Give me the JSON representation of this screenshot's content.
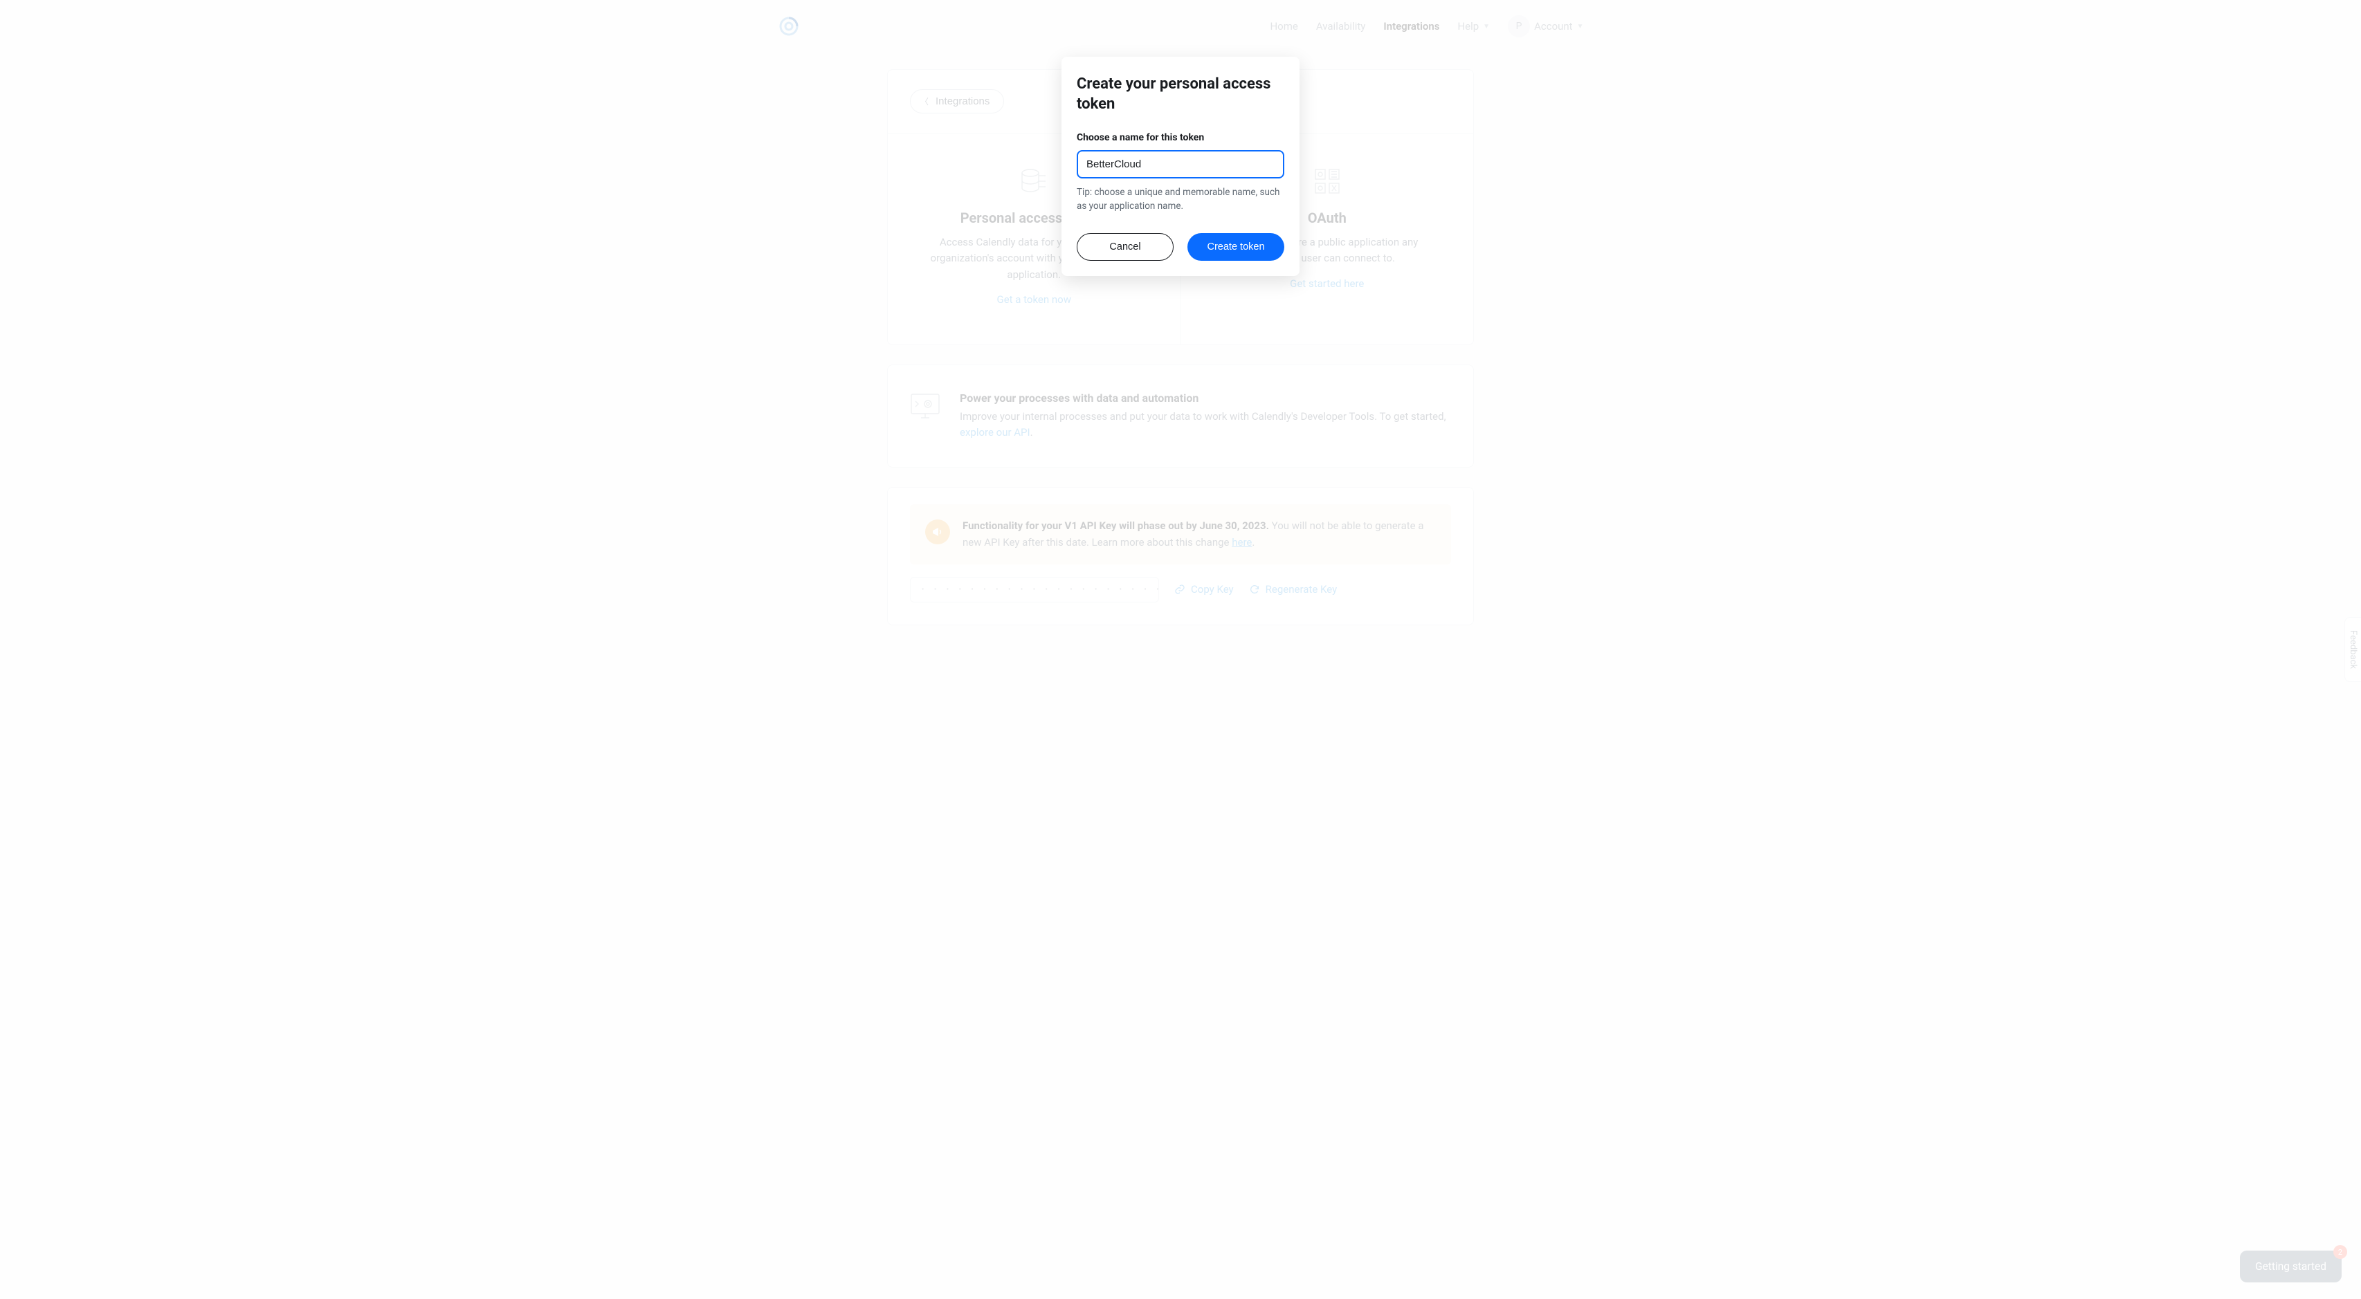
{
  "nav": {
    "home": "Home",
    "availability": "Availability",
    "integrations": "Integrations",
    "help": "Help",
    "account": "Account",
    "avatar_initial": "P"
  },
  "breadcrumb": {
    "back_label": "Integrations"
  },
  "cards": {
    "pat": {
      "title": "Personal access tokens",
      "body": "Access Calendly data for yourself or your organization's account with your own internal application.",
      "cta": "Get a token now"
    },
    "oauth": {
      "title": "OAuth",
      "body": "Build and share a public application any Calendly user can connect to.",
      "cta": "Get started here"
    }
  },
  "automation": {
    "title": "Power your processes with data and automation",
    "body_before_link": "Improve your internal processes and put your data to work with Calendly's Developer Tools. To get started, ",
    "link": "explore our API",
    "body_after_link": "."
  },
  "deprecation": {
    "bold": "Functionality for your V1 API Key will phase out by June 30, 2023.",
    "rest": " You will not be able to generate a new API Key after this date. Learn more about this change ",
    "link": "here",
    "tail": ".",
    "masked_key": "• • • • • • • • • • • • • • • • • • • • • • • • • • • • • • • • • • • • • • • • • • • • • • • •",
    "copy": "Copy Key",
    "regen": "Regenerate Key"
  },
  "modal": {
    "title": "Create your personal access token",
    "label": "Choose a name for this token",
    "value": "BetterCloud",
    "tip": "Tip: choose a unique and memorable name, such as your application name.",
    "cancel": "Cancel",
    "submit": "Create token"
  },
  "feedback_tab": "Feedback",
  "getting_started": {
    "label": "Getting started",
    "badge": "2"
  }
}
